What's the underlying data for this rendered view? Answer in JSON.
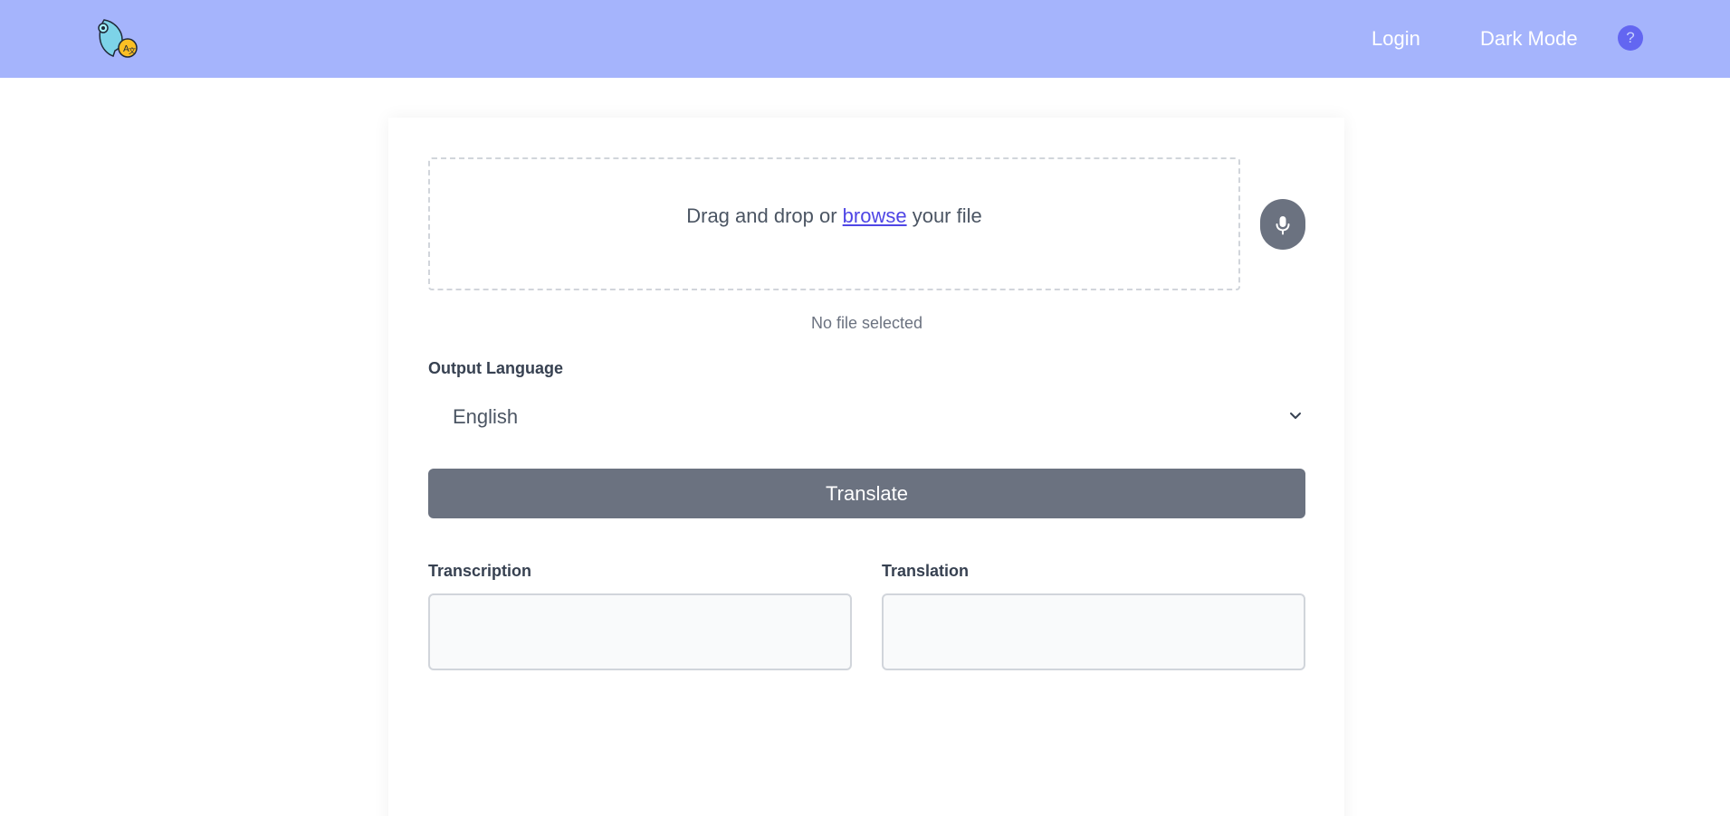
{
  "header": {
    "logo_icon": "face-translate-logo-icon",
    "login_label": "Login",
    "dark_mode_label": "Dark Mode",
    "help_label": "?",
    "background_color": "#a5b4fc"
  },
  "upload": {
    "prefix": "Drag and drop or ",
    "browse_label": "browse",
    "suffix": " your file",
    "mic_icon": "microphone-icon",
    "file_status": "No file selected"
  },
  "language": {
    "label": "Output Language",
    "selected": "English"
  },
  "translate_button": "Translate",
  "outputs": {
    "transcription_label": "Transcription",
    "translation_label": "Translation",
    "transcription_value": "",
    "translation_value": ""
  },
  "colors": {
    "accent": "#4f46e5",
    "button": "#6b7280"
  }
}
